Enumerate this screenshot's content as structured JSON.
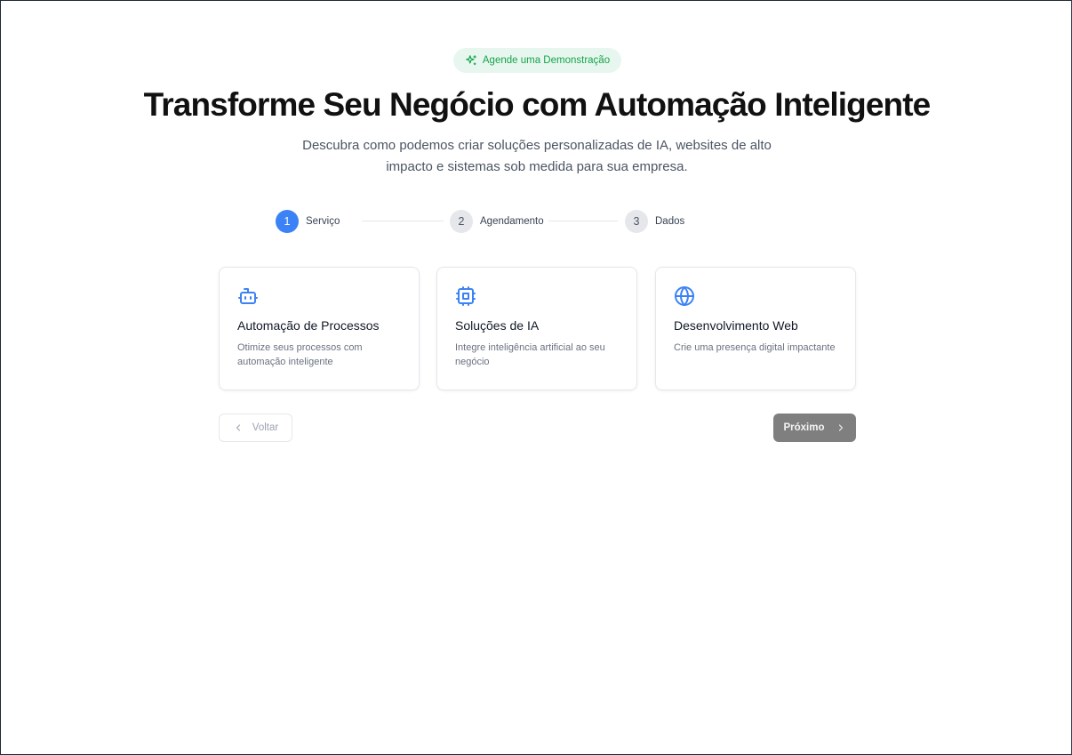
{
  "badge": {
    "label": "Agende uma Demonstração",
    "icon": "sparkles-icon",
    "color": "#16a34a"
  },
  "hero": {
    "title": "Transforme Seu Negócio com Automação Inteligente",
    "subtitle_line1": "Descubra como podemos criar soluções personalizadas de IA, websites de alto",
    "subtitle_line2": "impacto e sistemas sob medida para sua empresa."
  },
  "stepper": {
    "current_step": 1,
    "steps": [
      {
        "number": "1",
        "label": "Serviço"
      },
      {
        "number": "2",
        "label": "Agendamento"
      },
      {
        "number": "3",
        "label": "Dados"
      }
    ]
  },
  "services": [
    {
      "icon": "bot-icon",
      "title": "Automação de Processos",
      "description": "Otimize seus processos com automação inteligente"
    },
    {
      "icon": "cpu-icon",
      "title": "Soluções de IA",
      "description": "Integre inteligência artificial ao seu negócio"
    },
    {
      "icon": "globe-icon",
      "title": "Desenvolvimento Web",
      "description": "Crie uma presença digital impactante"
    }
  ],
  "nav": {
    "back_label": "Voltar",
    "next_label": "Próximo"
  },
  "colors": {
    "accent": "#3b82f6",
    "badge_bg": "#e7f7ef",
    "next_button_bg": "#7f7f7f"
  }
}
